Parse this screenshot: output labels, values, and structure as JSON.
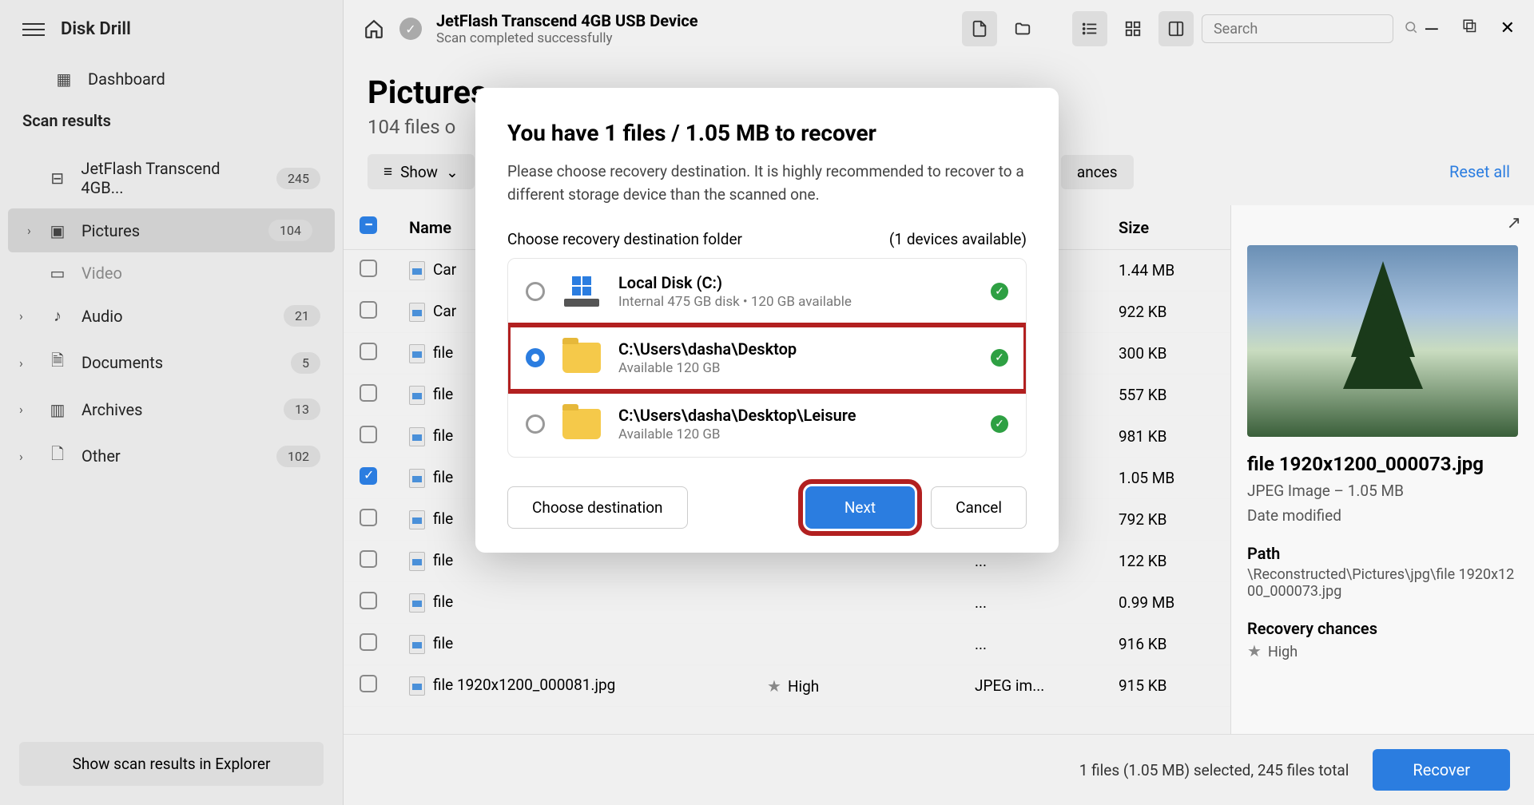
{
  "app": {
    "title": "Disk Drill"
  },
  "sidebar": {
    "dashboard": "Dashboard",
    "section_title": "Scan results",
    "items": [
      {
        "label": "JetFlash Transcend 4GB...",
        "count": "245",
        "icon": "drive"
      },
      {
        "label": "Pictures",
        "count": "104",
        "icon": "image",
        "active": true
      },
      {
        "label": "Video",
        "count": "",
        "icon": "film",
        "muted": true
      },
      {
        "label": "Audio",
        "count": "21",
        "icon": "note"
      },
      {
        "label": "Documents",
        "count": "5",
        "icon": "doc"
      },
      {
        "label": "Archives",
        "count": "13",
        "icon": "zip"
      },
      {
        "label": "Other",
        "count": "102",
        "icon": "file"
      }
    ],
    "footer_btn": "Show scan results in Explorer"
  },
  "topbar": {
    "device": "JetFlash Transcend 4GB USB Device",
    "status": "Scan completed successfully",
    "search_placeholder": "Search"
  },
  "content": {
    "title": "Pictures",
    "subtitle": "104 files o",
    "show": "Show",
    "chances_btn": "ances",
    "reset": "Reset all"
  },
  "table": {
    "col_name": "Name",
    "col_size": "Size",
    "rows": [
      {
        "name": "Car",
        "ext": "...",
        "chance": "",
        "size": "1.44 MB",
        "checked": false
      },
      {
        "name": "Car",
        "ext": "...",
        "chance": "",
        "size": "922 KB",
        "checked": false
      },
      {
        "name": "file",
        "ext": "...",
        "chance": "",
        "size": "300 KB",
        "checked": false
      },
      {
        "name": "file",
        "ext": "...",
        "chance": "",
        "size": "557 KB",
        "checked": false
      },
      {
        "name": "file",
        "ext": "...",
        "chance": "",
        "size": "981 KB",
        "checked": false
      },
      {
        "name": "file",
        "ext": "...",
        "chance": "",
        "size": "1.05 MB",
        "checked": true
      },
      {
        "name": "file",
        "ext": "...",
        "chance": "",
        "size": "792 KB",
        "checked": false
      },
      {
        "name": "file",
        "ext": "...",
        "chance": "",
        "size": "122 KB",
        "checked": false
      },
      {
        "name": "file",
        "ext": "...",
        "chance": "",
        "size": "0.99 MB",
        "checked": false
      },
      {
        "name": "file",
        "ext": "...",
        "chance": "",
        "size": "916 KB",
        "checked": false
      },
      {
        "name": "file 1920x1200_000081.jpg",
        "ext": "JPEG im...",
        "chance": "High",
        "size": "915 KB",
        "checked": false
      }
    ]
  },
  "preview": {
    "filename": "file 1920x1200_000073.jpg",
    "type_line": "JPEG Image – 1.05 MB",
    "date_label": "Date modified",
    "path_label": "Path",
    "path_value": "\\Reconstructed\\Pictures\\jpg\\file 1920x1200_000073.jpg",
    "chances_label": "Recovery chances",
    "chances_value": "High"
  },
  "bottombar": {
    "status": "1 files (1.05 MB) selected, 245 files total",
    "recover": "Recover"
  },
  "modal": {
    "title": "You have 1 files / 1.05 MB to recover",
    "desc": "Please choose recovery destination. It is highly recommended to recover to a different storage device than the scanned one.",
    "choose_label": "Choose recovery destination folder",
    "devices_label": "(1 devices available)",
    "destinations": [
      {
        "name": "Local Disk (C:)",
        "sub": "Internal 475 GB disk • 120 GB available",
        "type": "hdd",
        "selected": false
      },
      {
        "name": "C:\\Users\\dasha\\Desktop",
        "sub": "Available 120 GB",
        "type": "folder",
        "selected": true,
        "highlighted": true
      },
      {
        "name": "C:\\Users\\dasha\\Desktop\\Leisure",
        "sub": "Available 120 GB",
        "type": "folder",
        "selected": false
      }
    ],
    "choose_btn": "Choose destination",
    "next_btn": "Next",
    "cancel_btn": "Cancel"
  }
}
